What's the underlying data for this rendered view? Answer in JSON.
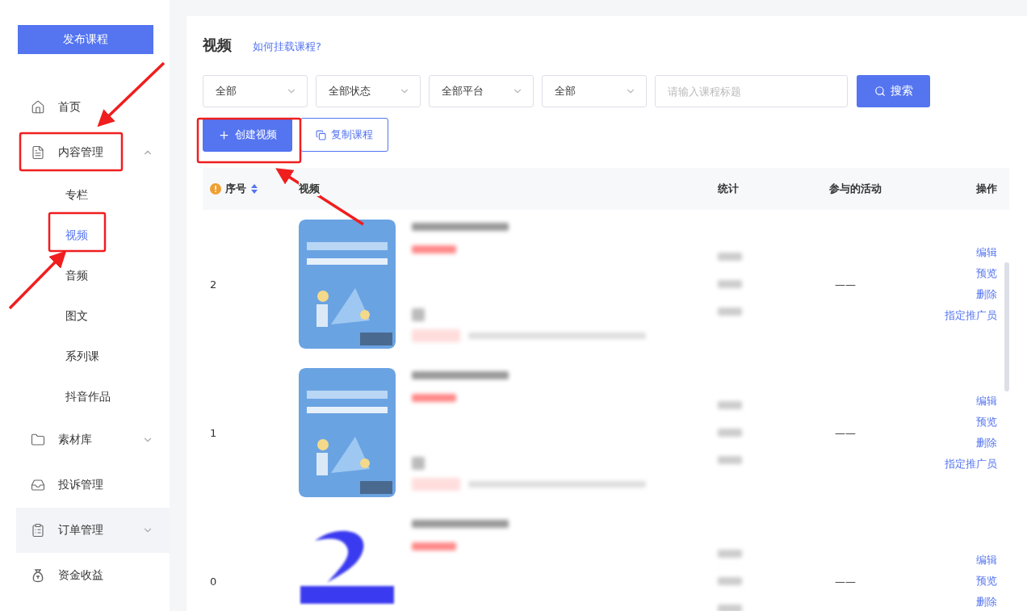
{
  "sidebar": {
    "publish_button": "发布课程",
    "items": [
      {
        "label": "首页",
        "hovered": false
      },
      {
        "label": "内容管理",
        "expanded": true,
        "hovered": false,
        "children": [
          {
            "label": "专栏",
            "selected": false
          },
          {
            "label": "视频",
            "selected": true
          },
          {
            "label": "音频",
            "selected": false
          },
          {
            "label": "图文",
            "selected": false
          },
          {
            "label": "系列课",
            "selected": false
          },
          {
            "label": "抖音作品",
            "selected": false
          }
        ]
      },
      {
        "label": "素材库",
        "expanded": false,
        "hovered": false
      },
      {
        "label": "投诉管理",
        "hovered": false
      },
      {
        "label": "订单管理",
        "expanded": false,
        "hovered": true
      },
      {
        "label": "资金收益",
        "hovered": false
      }
    ]
  },
  "page": {
    "title": "视频",
    "help_link": "如何挂载课程?"
  },
  "filters": [
    {
      "value": "全部"
    },
    {
      "value": "全部状态"
    },
    {
      "value": "全部平台"
    },
    {
      "value": "全部"
    }
  ],
  "search": {
    "placeholder": "请输入课程标题",
    "button": "搜索"
  },
  "actions": [
    {
      "label": "创建视频",
      "kind": "primary"
    },
    {
      "label": "复制课程",
      "kind": "outline"
    }
  ],
  "table": {
    "columns": [
      "序号",
      "视频",
      "统计",
      "参与的活动",
      "操作"
    ],
    "rows": [
      {
        "index": "2",
        "activity": "——",
        "actions": [
          "编辑",
          "预览",
          "删除",
          "指定推广员"
        ]
      },
      {
        "index": "1",
        "activity": "——",
        "actions": [
          "编辑",
          "预览",
          "删除",
          "指定推广员"
        ]
      },
      {
        "index": "0",
        "activity": "——",
        "actions": [
          "编辑",
          "预览",
          "删除"
        ]
      }
    ]
  }
}
